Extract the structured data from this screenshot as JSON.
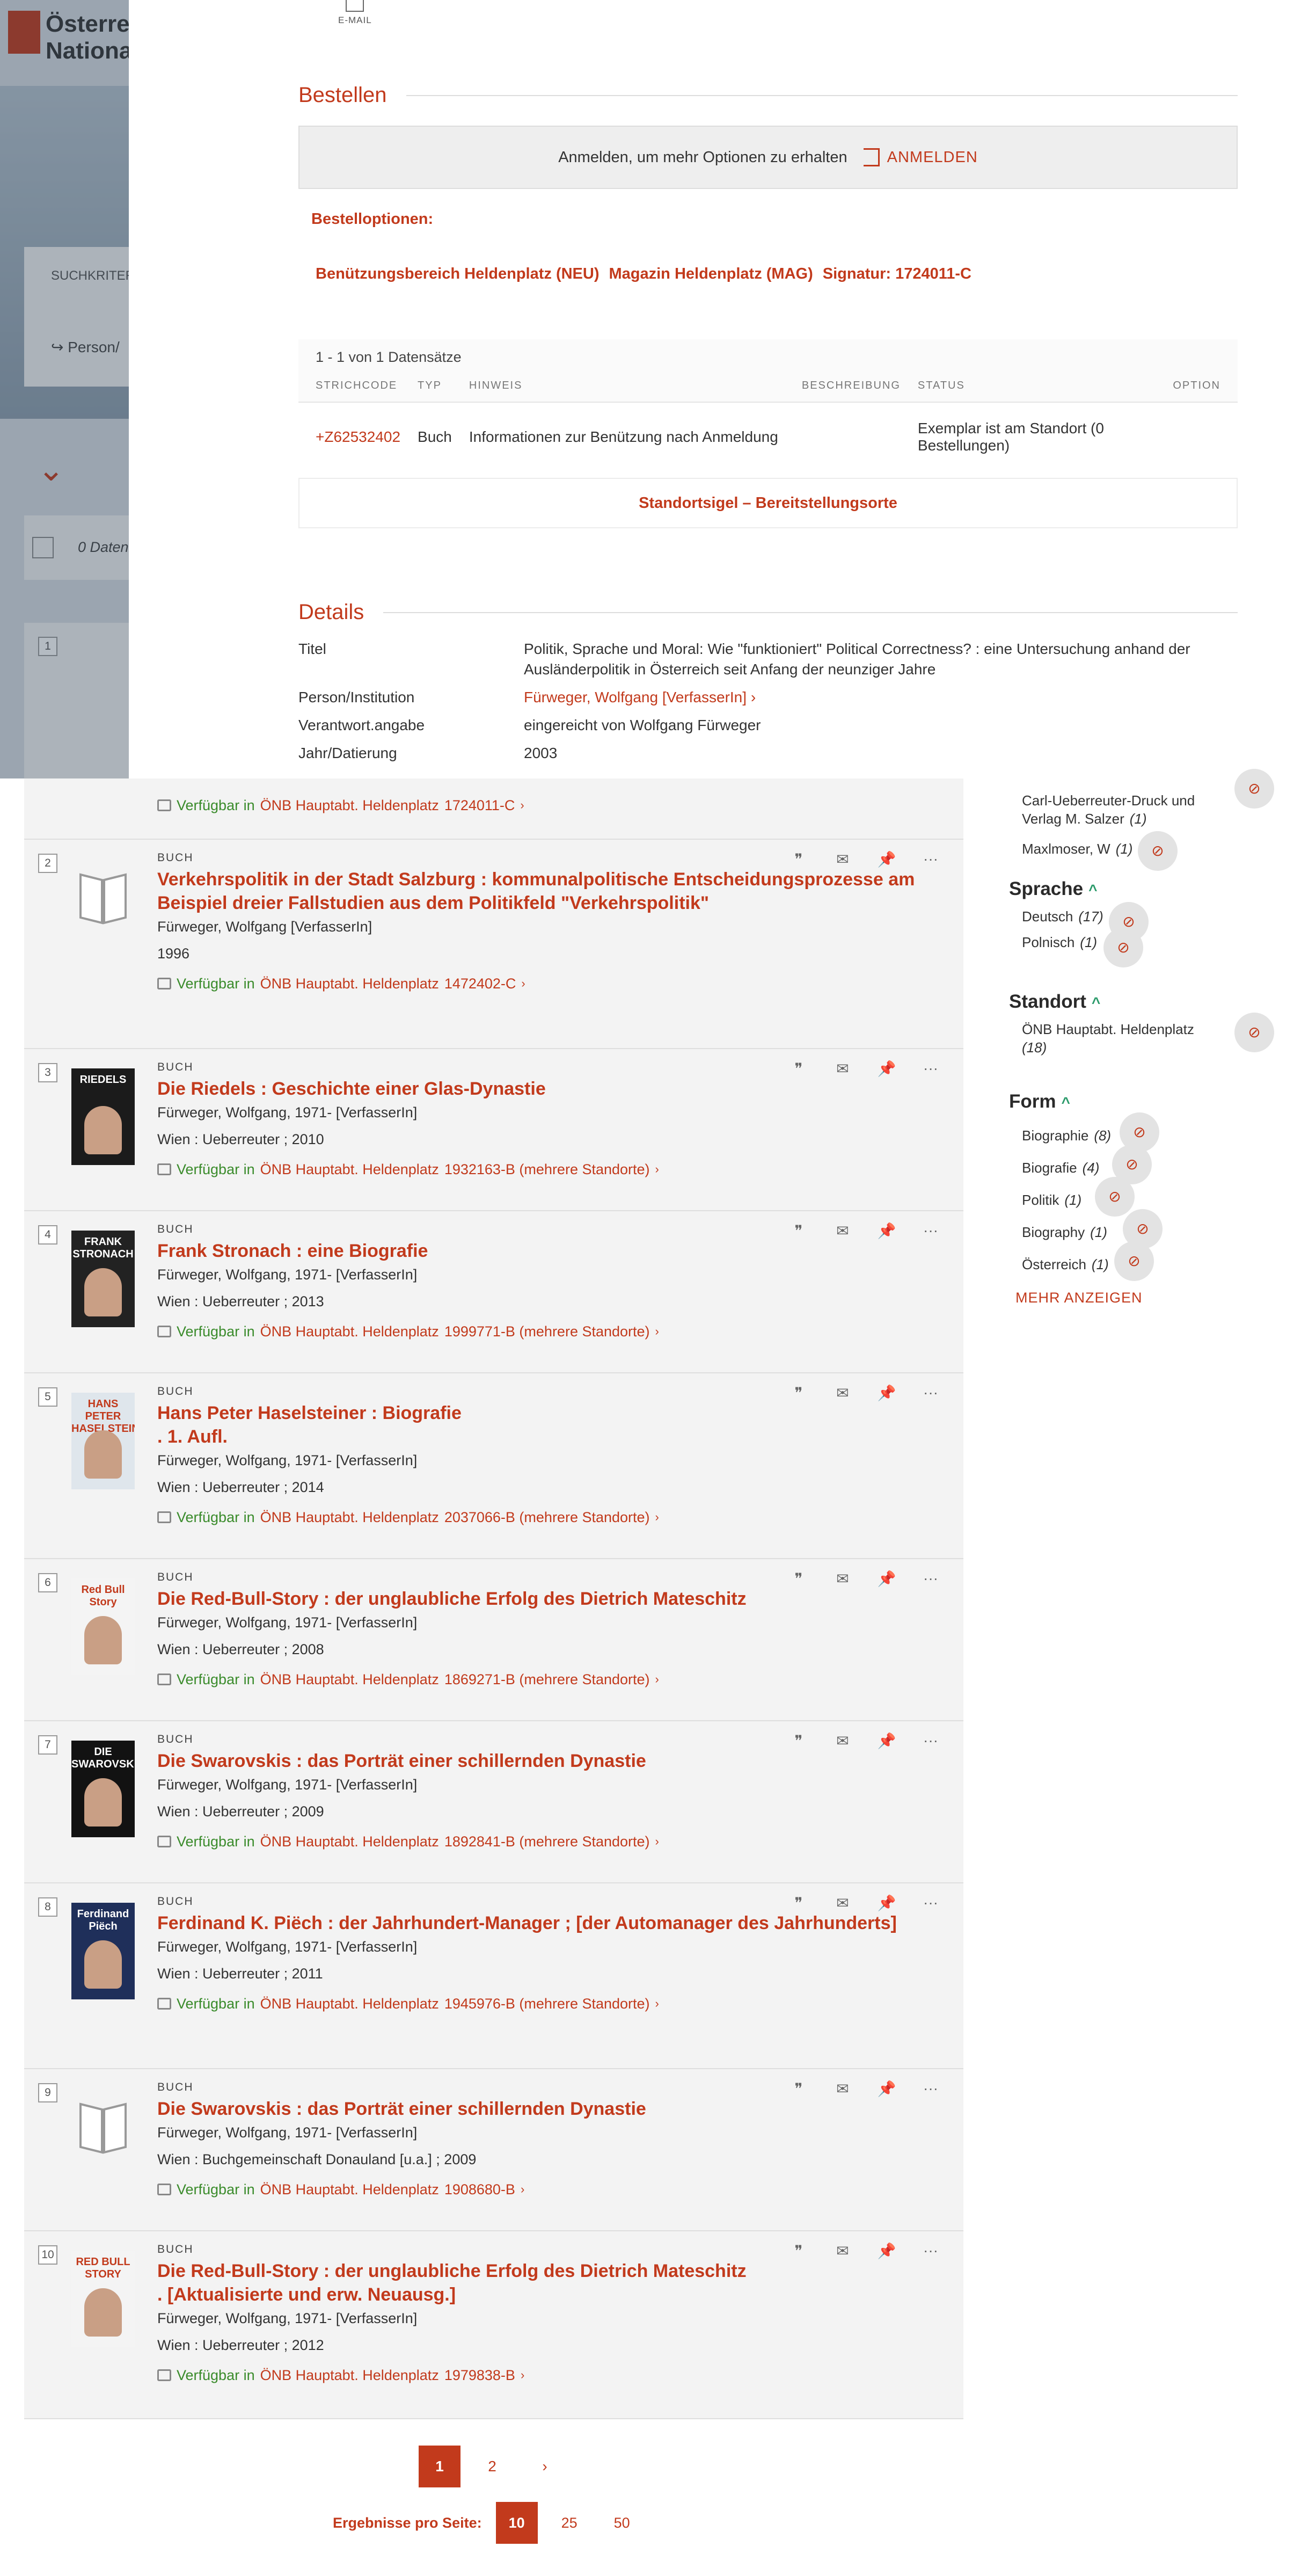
{
  "background": {
    "logo_line1": "Österreic",
    "logo_line2": "National",
    "criteria_label": "SUCHKRITER",
    "person_label": "Person/",
    "zero_records": "0 Daten",
    "first_rank": "1"
  },
  "overlay": {
    "email_label": "E-MAIL",
    "order_heading": "Bestellen",
    "login_prompt": "Anmelden, um mehr Optionen zu erhalten",
    "login_button": "ANMELDEN",
    "order_options_label": "Bestelloptionen:",
    "holding_area": "Benützungsbereich Heldenplatz (NEU)",
    "holding_magazine": "Magazin Heldenplatz (MAG)",
    "holding_signature": "Signatur: 1724011-C",
    "record_count": "1 - 1 von 1 Datensätze",
    "table_headers": [
      "STRICHCODE",
      "TYP",
      "HINWEIS",
      "BESCHREIBUNG",
      "STATUS",
      "OPTION"
    ],
    "table_row": {
      "barcode": "+Z62532402",
      "type": "Buch",
      "note": "Informationen zur Benützung nach Anmeldung",
      "description": "",
      "status": "Exemplar ist am Standort (0 Bestellungen)",
      "option": ""
    },
    "standort_link": "Standortsigel – Bereitstellungsorte",
    "details_heading": "Details",
    "details": [
      {
        "key": "Titel",
        "value": "Politik, Sprache und Moral: Wie \"funktioniert\" Political Correctness? : eine Untersuchung anhand der Ausländerpolitik in Österreich seit Anfang der neunziger Jahre",
        "link": false
      },
      {
        "key": "Person/Institution",
        "value": "Fürweger, Wolfgang [VerfasserIn]",
        "link": true
      },
      {
        "key": "Verantwort.angabe",
        "value": "eingereicht von Wolfgang Fürweger",
        "link": false
      },
      {
        "key": "Jahr/Datierung",
        "value": "2003",
        "link": false
      }
    ]
  },
  "first_result_tail": {
    "avail": "Verfügbar in",
    "location": "ÖNB Hauptabt. Heldenplatz",
    "signature": "1724011-C"
  },
  "results": [
    {
      "rank": "2",
      "type": "BUCH",
      "title": "Verkehrspolitik in der Stadt Salzburg : kommunalpolitische Entscheidungsprozesse am Beispiel dreier Fallstudien aus dem Politikfeld \"Verkehrspolitik\"",
      "edition": "",
      "author": "Fürweger, Wolfgang [VerfasserIn]",
      "imprint": "1996",
      "avail": "Verfügbar in",
      "location": "ÖNB Hauptabt. Heldenplatz",
      "signature": "1472402-C",
      "cover": "placeholder"
    },
    {
      "rank": "3",
      "type": "BUCH",
      "title": "Die Riedels : Geschichte einer Glas-Dynastie",
      "edition": "",
      "author": "Fürweger, Wolfgang, 1971- [VerfasserIn]",
      "imprint": "Wien : Ueberreuter ; 2010",
      "avail": "Verfügbar in",
      "location": "ÖNB Hauptabt. Heldenplatz",
      "signature": "1932163-B (mehrere Standorte)",
      "cover": "riedels"
    },
    {
      "rank": "4",
      "type": "BUCH",
      "title": "Frank Stronach : eine Biografie",
      "edition": "",
      "author": "Fürweger, Wolfgang, 1971- [VerfasserIn]",
      "imprint": "Wien : Ueberreuter ; 2013",
      "avail": "Verfügbar in",
      "location": "ÖNB Hauptabt. Heldenplatz",
      "signature": "1999771-B (mehrere Standorte)",
      "cover": "stronach"
    },
    {
      "rank": "5",
      "type": "BUCH",
      "title": "Hans Peter Haselsteiner : Biografie",
      "edition": ". 1. Aufl.",
      "author": "Fürweger, Wolfgang, 1971- [VerfasserIn]",
      "imprint": "Wien : Ueberreuter ; 2014",
      "avail": "Verfügbar in",
      "location": "ÖNB Hauptabt. Heldenplatz",
      "signature": "2037066-B (mehrere Standorte)",
      "cover": "haselsteiner"
    },
    {
      "rank": "6",
      "type": "BUCH",
      "title": "Die Red-Bull-Story : der unglaubliche Erfolg des Dietrich Mateschitz",
      "edition": "",
      "author": "Fürweger, Wolfgang, 1971- [VerfasserIn]",
      "imprint": "Wien : Ueberreuter ; 2008",
      "avail": "Verfügbar in",
      "location": "ÖNB Hauptabt. Heldenplatz",
      "signature": "1869271-B (mehrere Standorte)",
      "cover": "redbull"
    },
    {
      "rank": "7",
      "type": "BUCH",
      "title": "Die Swarovskis : das Porträt einer schillernden Dynastie",
      "edition": "",
      "author": "Fürweger, Wolfgang, 1971- [VerfasserIn]",
      "imprint": "Wien : Ueberreuter ; 2009",
      "avail": "Verfügbar in",
      "location": "ÖNB Hauptabt. Heldenplatz",
      "signature": "1892841-B (mehrere Standorte)",
      "cover": "swarovski"
    },
    {
      "rank": "8",
      "type": "BUCH",
      "title": "Ferdinand K. Piëch : der Jahrhundert-Manager ; [der Automanager des Jahrhunderts]",
      "edition": "",
      "author": "Fürweger, Wolfgang, 1971- [VerfasserIn]",
      "imprint": "Wien : Ueberreuter ; 2011",
      "avail": "Verfügbar in",
      "location": "ÖNB Hauptabt. Heldenplatz",
      "signature": "1945976-B (mehrere Standorte)",
      "cover": "piech"
    },
    {
      "rank": "9",
      "type": "BUCH",
      "title": "Die Swarovskis : das Porträt einer schillernden Dynastie",
      "edition": "",
      "author": "Fürweger, Wolfgang, 1971- [VerfasserIn]",
      "imprint": "Wien : Buchgemeinschaft Donauland [u.a.] ; 2009",
      "avail": "Verfügbar in",
      "location": "ÖNB Hauptabt. Heldenplatz",
      "signature": "1908680-B",
      "cover": "placeholder"
    },
    {
      "rank": "10",
      "type": "BUCH",
      "title": "Die Red-Bull-Story : der unglaubliche Erfolg des Dietrich Mateschitz",
      "edition": ". [Aktualisierte und erw. Neuausg.]",
      "author": "Fürweger, Wolfgang, 1971- [VerfasserIn]",
      "imprint": "Wien : Ueberreuter ; 2012",
      "avail": "Verfügbar in",
      "location": "ÖNB Hauptabt. Heldenplatz",
      "signature": "1979838-B",
      "cover": "redbull2"
    }
  ],
  "covers": {
    "riedels": {
      "text": "RIEDELS",
      "bg": "#1b1b1b"
    },
    "stronach": {
      "text": "FRANK STRONACH",
      "bg": "#222222"
    },
    "haselsteiner": {
      "text": "HANS PETER HASELSTEINER",
      "bg": "#dfe6ec"
    },
    "redbull": {
      "text": "Red Bull Story",
      "bg": "#f4f4f4"
    },
    "swarovski": {
      "text": "DIE SWAROVSKIS",
      "bg": "#121212"
    },
    "piech": {
      "text": "Ferdinand Piëch",
      "bg": "#1f2f5a"
    },
    "redbull2": {
      "text": "RED BULL STORY",
      "bg": "#f4f4f4"
    }
  },
  "facets": {
    "publisher_items": [
      {
        "label": "Carl-Ueberreuter-Druck und Verlag M. Salzer",
        "count": "(1)"
      },
      {
        "label": "Maxlmoser, W",
        "count": "(1)"
      }
    ],
    "language_title": "Sprache",
    "language_items": [
      {
        "label": "Deutsch",
        "count": "(17)"
      },
      {
        "label": "Polnisch",
        "count": "(1)"
      }
    ],
    "location_title": "Standort",
    "location_items": [
      {
        "label": "ÖNB Hauptabt. Heldenplatz",
        "count": "(18)"
      }
    ],
    "form_title": "Form",
    "form_items": [
      {
        "label": "Biographie",
        "count": "(8)"
      },
      {
        "label": "Biografie",
        "count": "(4)"
      },
      {
        "label": "Politik",
        "count": "(1)"
      },
      {
        "label": "Biography",
        "count": "(1)"
      },
      {
        "label": "Österreich",
        "count": "(1)"
      }
    ],
    "more_link": "MEHR ANZEIGEN"
  },
  "pagination": {
    "pages": [
      "1",
      "2"
    ],
    "next": "›",
    "per_page_label": "Ergebnisse pro Seite:",
    "per_page_options": [
      "10",
      "25",
      "50"
    ]
  },
  "colors": {
    "accent": "#c23a1c",
    "available": "#3a8b2b"
  }
}
